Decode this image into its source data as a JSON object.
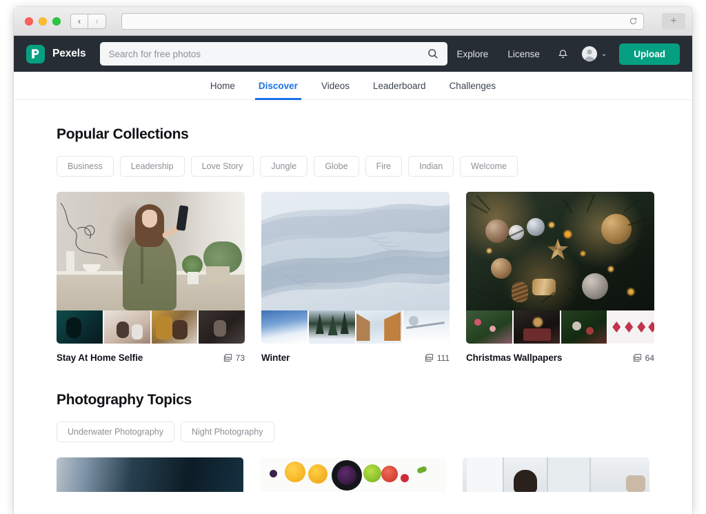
{
  "browser": {
    "url": "",
    "reload_icon": "reload-icon",
    "new_tab_label": "+",
    "back_label": "‹",
    "forward_label": "›"
  },
  "header": {
    "logo_text": "Pexels",
    "search_placeholder": "Search for free photos",
    "links": [
      {
        "label": "Explore"
      },
      {
        "label": "License"
      }
    ],
    "upload_label": "Upload",
    "chevron": "⌄",
    "accent_color": "#05a081",
    "bar_color": "#262d35"
  },
  "subnav": {
    "active_color": "#1a73e8",
    "items": [
      {
        "label": "Home",
        "active": false
      },
      {
        "label": "Discover",
        "active": true
      },
      {
        "label": "Videos",
        "active": false
      },
      {
        "label": "Leaderboard",
        "active": false
      },
      {
        "label": "Challenges",
        "active": false
      }
    ]
  },
  "collections_section": {
    "title": "Popular Collections",
    "tags": [
      {
        "label": "Business"
      },
      {
        "label": "Leadership"
      },
      {
        "label": "Love Story"
      },
      {
        "label": "Jungle"
      },
      {
        "label": "Globe"
      },
      {
        "label": "Fire"
      },
      {
        "label": "Indian"
      },
      {
        "label": "Welcome"
      }
    ],
    "cards": [
      {
        "title": "Stay At Home Selfie",
        "count": "73"
      },
      {
        "title": "Winter",
        "count": "111"
      },
      {
        "title": "Christmas Wallpapers",
        "count": "64"
      }
    ]
  },
  "topics_section": {
    "title": "Photography Topics",
    "tags": [
      {
        "label": "Underwater Photography"
      },
      {
        "label": "Night Photography"
      }
    ]
  }
}
